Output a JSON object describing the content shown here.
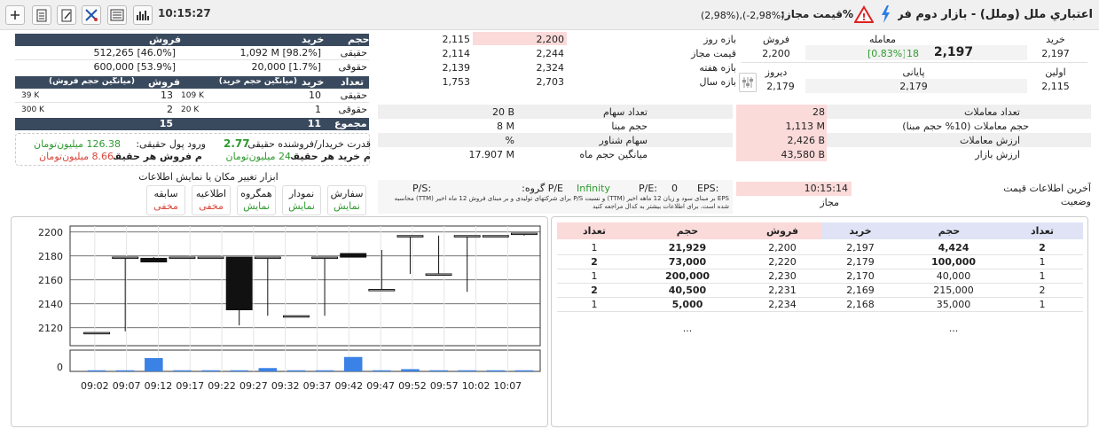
{
  "header": {
    "time": "10:15:27",
    "symbol_title": "اعتباري ملل (وملل) - بازار دوم فرابورس",
    "price_change_label": "%قیمت مجاز:",
    "price_change_value": "(2,98%),(-2,98%)"
  },
  "quote": {
    "buy_label": "خرید",
    "trade_label": "معامله",
    "sell_label": "فروش",
    "buy_value": "2,197",
    "trade_value": "2,197",
    "trade_change": "18",
    "trade_change_pct": "[0.83%]",
    "sell_value": "2,200",
    "first_label": "اولین",
    "last_label": "پایانی",
    "yesterday_label": "دیروز",
    "first_value": "2,115",
    "last_value": "2,179",
    "yesterday_value": "2,179"
  },
  "ranges": {
    "day_label": "بازه روز",
    "allowed_label": "قیمت مجاز",
    "week_label": "بازه هفته",
    "year_label": "بازه سال",
    "rows": [
      {
        "high": "2,200",
        "low": "2,115"
      },
      {
        "high": "2,244",
        "low": "2,114"
      },
      {
        "high": "2,324",
        "low": "2,139"
      },
      {
        "high": "2,703",
        "low": "1,753"
      }
    ]
  },
  "volume_summary": {
    "headers": {
      "volume": "حجم",
      "buy": "خرید",
      "sell": "فروش"
    },
    "rows": [
      {
        "label": "حقیقی",
        "buy": "1,092 M [98.2%]",
        "sell": "512,265 [46.0%]"
      },
      {
        "label": "حقوقی",
        "buy": "20,000 [1.7%]",
        "sell": "600,000 [53.9%]"
      }
    ]
  },
  "count_summary": {
    "headers": {
      "count": "تعداد",
      "buy": "خرید",
      "buy_avg": "(میانگین حجم خرید)",
      "sell": "فروش",
      "sell_avg": "(میانگین حجم فروش)"
    },
    "rows": [
      {
        "label": "حقیقی",
        "buy": "10",
        "buy_avg": "109 K",
        "sell": "13",
        "sell_avg": "39 K"
      },
      {
        "label": "حقوقی",
        "buy": "1",
        "buy_avg": "20 K",
        "sell": "2",
        "sell_avg": "300 K"
      }
    ],
    "total_label": "مجموع",
    "total_buy": "11",
    "total_sell": "15"
  },
  "power": {
    "ratio_label": "قدرت خریدار/فروشنده حقیقی:",
    "ratio_value": "2.77",
    "inflow_label": "ورود پول حقیقی:",
    "inflow_value": "126.38 میلیون‌تومان",
    "per_buy_label": "م خرید هر حقیقی:",
    "per_buy_value": "24 میلیون‌تومان",
    "per_sell_label": "م فروش هر حقیقی:",
    "per_sell_value": "8.66 میلیون‌تومان"
  },
  "tools": {
    "title": "ابزار تغییر مکان یا نمایش اطلاعات",
    "items": [
      {
        "name": "سفارش",
        "state": "نمایش"
      },
      {
        "name": "نمودار",
        "state": "نمایش"
      },
      {
        "name": "همگروه",
        "state": "نمایش"
      },
      {
        "name": "اطلاعیه",
        "state": "مخفی"
      },
      {
        "name": "سابقه",
        "state": "مخفی"
      }
    ]
  },
  "stats": {
    "rows": [
      {
        "label": "تعداد معاملات",
        "value": "28"
      },
      {
        "label": "حجم معاملات (10% حجم مبنا)",
        "value": "1,113 M"
      },
      {
        "label": "ارزش معاملات",
        "value": "2,426 B"
      },
      {
        "label": "ارزش بازار",
        "value": "43,580 B"
      }
    ],
    "last_info_label": "آخرین اطلاعات قیمت",
    "last_info_value": "10:15:14",
    "status_label": "وضعیت",
    "status_value": "مجاز"
  },
  "shares": {
    "rows": [
      {
        "label": "تعداد سهام",
        "value": "20 B"
      },
      {
        "label": "حجم مبنا",
        "value": "8 M"
      },
      {
        "label": "سهام شناور",
        "value": "%"
      },
      {
        "label": "میانگین حجم ماه",
        "value": "17.907 M"
      }
    ]
  },
  "ratios": {
    "eps_label": "EPS:",
    "eps_value": "0",
    "pe_label": "P/E:",
    "pe_value": "Infinity",
    "group_pe_label": "P/E گروه:",
    "ps_label": "P/S:",
    "note": "EPS بر مبنای سود و زیان 12 ماهه اخیر (TTM) و نسبت P/S برای شرکتهای تولیدی و بر مبنای فروش 12 ماه اخیر (TTM) محاسبه شده است.  برای اطلاعات بیشتر به کدال مراجعه کنید"
  },
  "orderbook": {
    "headers": {
      "count": "تعداد",
      "volume": "حجم",
      "buy": "خرید",
      "sell": "فروش"
    },
    "rows": [
      {
        "buy_count": "2",
        "buy_vol": "4,424",
        "buy_price": "2,197",
        "sell_price": "2,200",
        "sell_vol": "21,929",
        "sell_count": "1"
      },
      {
        "buy_count": "1",
        "buy_vol": "100,000",
        "buy_price": "2,179",
        "sell_price": "2,220",
        "sell_vol": "73,000",
        "sell_count": "2"
      },
      {
        "buy_count": "1",
        "buy_vol": "40,000",
        "buy_price": "2,170",
        "sell_price": "2,230",
        "sell_vol": "200,000",
        "sell_count": "1"
      },
      {
        "buy_count": "2",
        "buy_vol": "215,000",
        "buy_price": "2,169",
        "sell_price": "2,231",
        "sell_vol": "40,500",
        "sell_count": "2"
      },
      {
        "buy_count": "1",
        "buy_vol": "35,000",
        "buy_price": "2,168",
        "sell_price": "2,234",
        "sell_vol": "5,000",
        "sell_count": "1"
      }
    ],
    "more": "..."
  },
  "colors": {
    "accent_dark": "#3a4a5e",
    "pink": "#fbdada",
    "green": "#2e9a2e",
    "red": "#d9463b",
    "bid_header": "#dfe3f5",
    "ask_header": "#fbdada"
  },
  "chart_data": {
    "type": "candlestick",
    "ylim": [
      2105,
      2205
    ],
    "yticks": [
      2120,
      2140,
      2160,
      2180,
      2200
    ],
    "xticks": [
      "09:02",
      "09:07",
      "09:12",
      "09:17",
      "09:22",
      "09:27",
      "09:32",
      "09:37",
      "09:42",
      "09:47",
      "09:52",
      "09:57",
      "10:02",
      "10:07"
    ],
    "candles": [
      {
        "open": 2115,
        "close": 2116,
        "high": 2116,
        "low": 2115,
        "volume": 0.5
      },
      {
        "open": 2178,
        "close": 2179,
        "high": 2179,
        "low": 2117,
        "volume": 0.5
      },
      {
        "open": 2178,
        "close": 2175,
        "high": 2179,
        "low": 2175,
        "volume": 6
      },
      {
        "open": 2179,
        "close": 2179,
        "high": 2179,
        "low": 2179,
        "volume": 0.5
      },
      {
        "open": 2179,
        "close": 2179,
        "high": 2179,
        "low": 2179,
        "volume": 0.5
      },
      {
        "open": 2179,
        "close": 2135,
        "high": 2179,
        "low": 2122,
        "volume": 0.5
      },
      {
        "open": 2179,
        "close": 2179,
        "high": 2179,
        "low": 2130,
        "volume": 1.5
      },
      {
        "open": 2130,
        "close": 2130,
        "high": 2130,
        "low": 2130,
        "volume": 0.5
      },
      {
        "open": 2179,
        "close": 2179,
        "high": 2179,
        "low": 2130,
        "volume": 0.5
      },
      {
        "open": 2182,
        "close": 2179,
        "high": 2182,
        "low": 2179,
        "volume": 6.5
      },
      {
        "open": 2152,
        "close": 2152,
        "high": 2185,
        "low": 2152,
        "volume": 0.5
      },
      {
        "open": 2197,
        "close": 2197,
        "high": 2197,
        "low": 2165,
        "volume": 1
      },
      {
        "open": 2165,
        "close": 2165,
        "high": 2197,
        "low": 2165,
        "volume": 0.5
      },
      {
        "open": 2197,
        "close": 2197,
        "high": 2197,
        "low": 2150,
        "volume": 0.5
      },
      {
        "open": 2197,
        "close": 2197,
        "high": 2197,
        "low": 2197,
        "volume": 0.5
      },
      {
        "open": 2199,
        "close": 2199,
        "high": 2199,
        "low": 2197,
        "volume": 0.5
      }
    ],
    "volume_ytick": "0"
  }
}
